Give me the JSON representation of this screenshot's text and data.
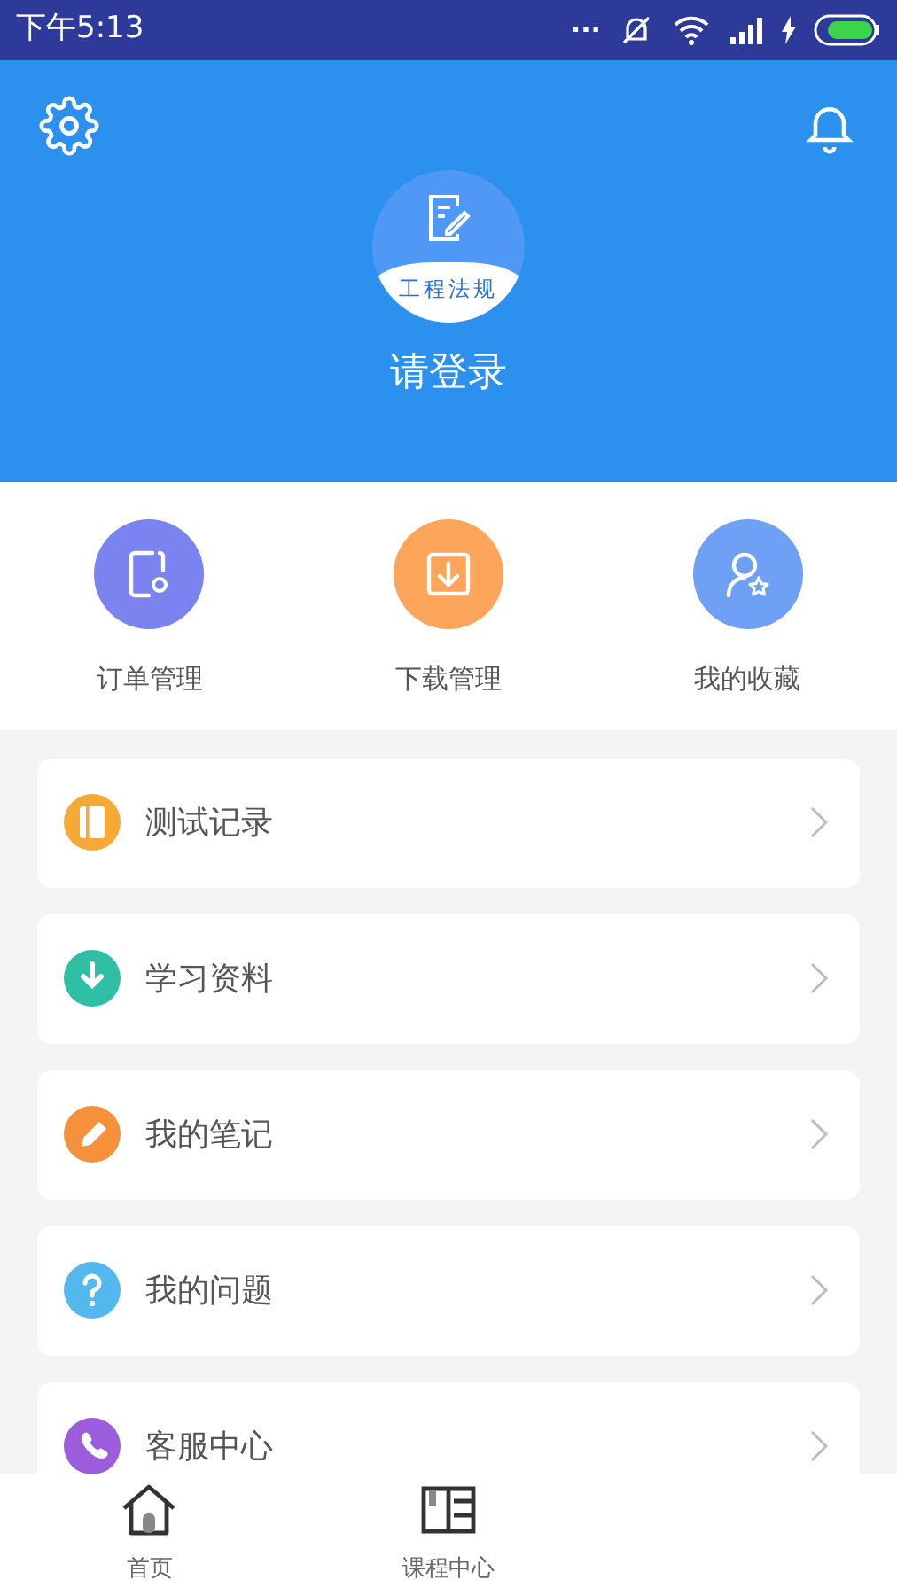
{
  "status_bar": {
    "time": "下午5:13",
    "dots": "..."
  },
  "header": {
    "badge_text": "工程法规",
    "login": "请登录"
  },
  "quick_actions": [
    {
      "label": "订单管理",
      "kind": "orders",
      "color": "#7b83f0"
    },
    {
      "label": "下载管理",
      "kind": "download",
      "color": "#fda55a"
    },
    {
      "label": "我的收藏",
      "kind": "favorites",
      "color": "#6ea0f6"
    }
  ],
  "menu": [
    {
      "label": "测试记录",
      "kind": "record",
      "color": "#f7a935"
    },
    {
      "label": "学习资料",
      "kind": "materials",
      "color": "#2ebfa5"
    },
    {
      "label": "我的笔记",
      "kind": "notes",
      "color": "#f5913a"
    },
    {
      "label": "我的问题",
      "kind": "questions",
      "color": "#52b8ee"
    },
    {
      "label": "客服中心",
      "kind": "service",
      "color": "#9b5ddc"
    }
  ],
  "tab_bar": [
    {
      "label": "首页",
      "kind": "home"
    },
    {
      "label": "课程中心",
      "kind": "courses"
    }
  ]
}
